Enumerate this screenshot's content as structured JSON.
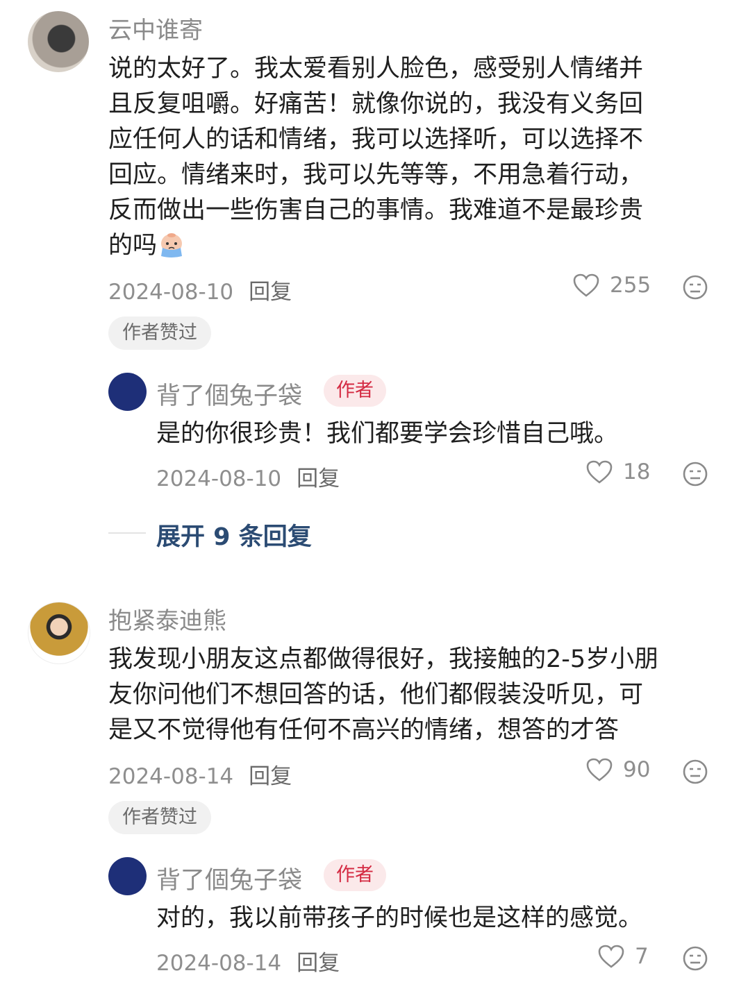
{
  "comments": [
    {
      "username": "云中谁寄",
      "text_lines": [
        "说的太好了。我太爱看别人脸色，感受别人情绪并",
        "且反复咀嚼。好痛苦！就像你说的，我没有义务回",
        "应任何人的话和情绪，我可以选择听，可以选择不",
        "回应。情绪来时，我可以先等等，不用急着行动，",
        "反而做出一些伤害自己的事情。我难道不是最珍贵",
        "的吗"
      ],
      "emoji_icon": "crying-face-emoji",
      "date": "2024-08-10",
      "reply_label": "回复",
      "likes": "255",
      "tag": "作者赞过",
      "reply": {
        "username": "背了個兔子袋",
        "badge": "作者",
        "text": "是的你很珍贵！我们都要学会珍惜自己哦。",
        "date": "2024-08-10",
        "reply_label": "回复",
        "likes": "18"
      },
      "expand_label": "展开 9 条回复"
    },
    {
      "username": "抱紧泰迪熊",
      "text_lines": [
        "我发现小朋友这点都做得很好，我接触的2-5岁小朋",
        "友你问他们不想回答的话，他们都假装没听见，可",
        "是又不觉得他有任何不高兴的情绪，想答的才答"
      ],
      "date": "2024-08-14",
      "reply_label": "回复",
      "likes": "90",
      "tag": "作者赞过",
      "reply": {
        "username": "背了個兔子袋",
        "badge": "作者",
        "text": "对的，我以前带孩子的时候也是这样的感觉。",
        "date": "2024-08-14",
        "reply_label": "回复",
        "likes": "7"
      }
    }
  ],
  "icons": {
    "like": "heart-outline-icon",
    "dislike": "neutral-face-icon"
  },
  "colors": {
    "author_badge_bg": "#fbe9ea",
    "author_badge_text": "#d42a42",
    "expand_text": "#2b4b73",
    "reply_avatar": "#1e2f78"
  }
}
